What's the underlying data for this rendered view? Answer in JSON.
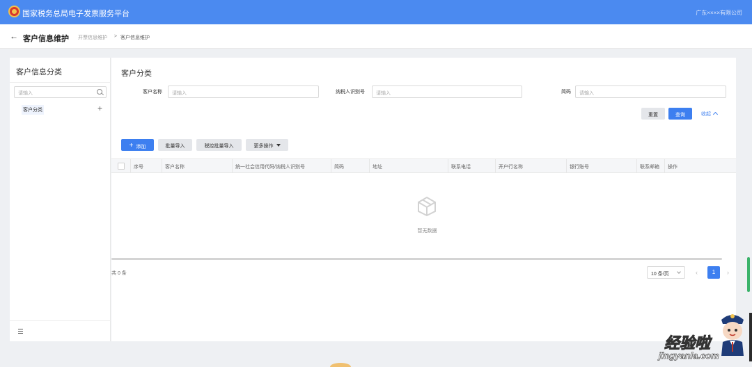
{
  "app": {
    "title": "国家税务总局电子发票服务平台",
    "company": "广东××××有限公司"
  },
  "subheader": {
    "page_title": "客户信息维护",
    "breadcrumb": [
      "开票信息维护",
      ">",
      "客户信息维护"
    ]
  },
  "sidebar": {
    "title": "客户信息分类",
    "search_placeholder": "请输入",
    "tree": [
      {
        "label": "客户分类"
      }
    ]
  },
  "main": {
    "section_title": "客户分类",
    "filters": {
      "customer_name": {
        "label": "客户名称",
        "placeholder": "请输入"
      },
      "tax_id": {
        "label": "纳税人识别号",
        "placeholder": "请输入"
      },
      "short_code": {
        "label": "简码",
        "placeholder": "请输入"
      }
    },
    "buttons": {
      "reset": "重置",
      "query": "查询",
      "collapse": "收起",
      "add": "添加",
      "batch_import": "批量导入",
      "tax_batch_import": "税控批量导入",
      "more_actions": "更多操作"
    },
    "table": {
      "columns": [
        "序号",
        "客户名称",
        "统一社会信用代码/纳税人识别号",
        "简码",
        "地址",
        "联系电话",
        "开户行名称",
        "银行账号",
        "联系邮箱",
        "操作"
      ],
      "rows": [],
      "empty_text": "暂无数据"
    },
    "pagination": {
      "total_text": "共 0 条",
      "page_size": "10 条/页",
      "current_page": "1"
    }
  },
  "overlay": {
    "watermark": "经验啦",
    "watermark_sub": "jingyanla.com"
  },
  "colors": {
    "primary": "#3d7ff0",
    "header": "#4b8af0",
    "background": "#eef0f3"
  }
}
